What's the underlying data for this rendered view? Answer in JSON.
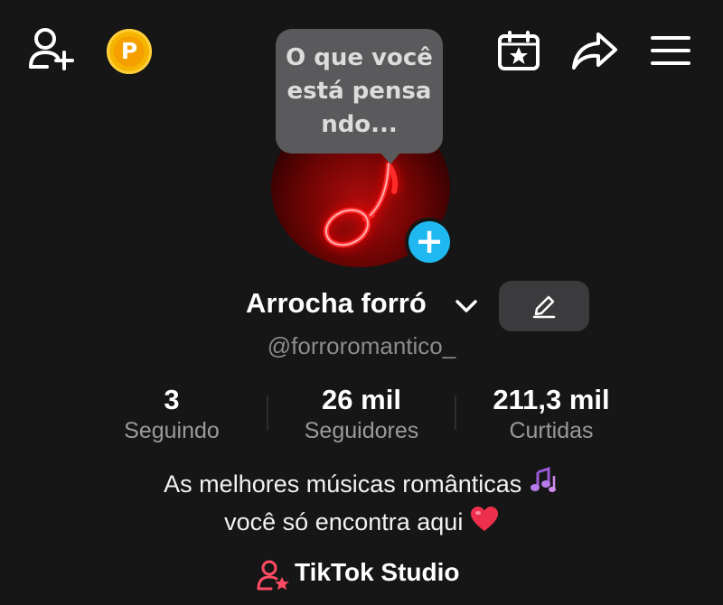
{
  "topbar": {
    "add_friend_icon": "add-friend-icon",
    "coin_icon": "coin-icon",
    "coin_letter": "P",
    "calendar_icon": "calendar-star-icon",
    "share_icon": "share-icon",
    "menu_icon": "hamburger-menu-icon"
  },
  "tooltip": {
    "text": "O que você\nestá pensa\nndo..."
  },
  "profile": {
    "avatar_icon": "music-note-icon",
    "add_photo_icon": "plus-icon",
    "add_symbol": "+",
    "display_name": "Arrocha forró",
    "username": "@forroromantico_",
    "edit_icon": "pencil-icon"
  },
  "stats": [
    {
      "value": "3",
      "label": "Seguindo"
    },
    {
      "value": "26 mil",
      "label": "Seguidores"
    },
    {
      "value": "211,3 mil",
      "label": "Curtidas"
    }
  ],
  "bio": {
    "line1": "As melhores músicas românticas",
    "line2": "você só encontra aqui"
  },
  "studio": {
    "label": "TikTok Studio",
    "icon": "person-star-icon"
  },
  "colors": {
    "background": "#161616",
    "accent_blue": "#20b8f0",
    "coin": "#f4b400",
    "avatar_red": "#b10c0c"
  }
}
